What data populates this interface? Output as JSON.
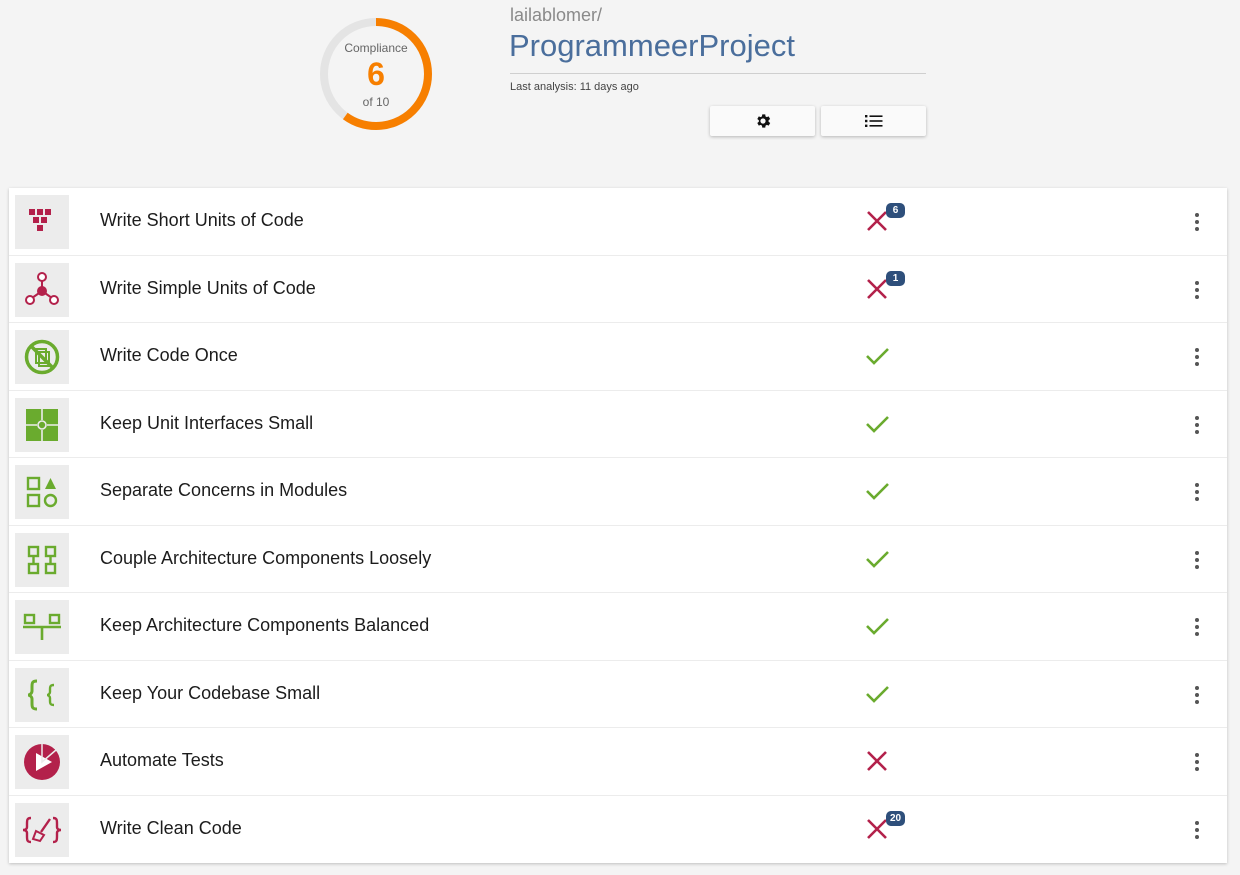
{
  "compliance": {
    "label": "Compliance",
    "score": "6",
    "of_label": "of 10",
    "fraction": 0.6,
    "color": "#f77f00"
  },
  "project": {
    "owner": "lailablomer/",
    "name": "ProgrammeerProject",
    "last_analysis": "Last analysis: 11 days ago"
  },
  "toolbar": {
    "settings_icon": "gear-icon",
    "list_icon": "list-icon"
  },
  "colors": {
    "fail": "#b3214b",
    "pass": "#6aab2e",
    "badge": "#2e4f7b",
    "title": "#4a6e9c"
  },
  "guidelines": [
    {
      "title": "Write Short Units of Code",
      "icon": "short-units-icon",
      "status": "fail",
      "count": "6"
    },
    {
      "title": "Write Simple Units of Code",
      "icon": "simple-units-icon",
      "status": "fail",
      "count": "1"
    },
    {
      "title": "Write Code Once",
      "icon": "no-duplication-icon",
      "status": "pass",
      "count": ""
    },
    {
      "title": "Keep Unit Interfaces Small",
      "icon": "puzzle-icon",
      "status": "pass",
      "count": ""
    },
    {
      "title": "Separate Concerns in Modules",
      "icon": "modules-icon",
      "status": "pass",
      "count": ""
    },
    {
      "title": "Couple Architecture Components Loosely",
      "icon": "components-icon",
      "status": "pass",
      "count": ""
    },
    {
      "title": "Keep Architecture Components Balanced",
      "icon": "balance-icon",
      "status": "pass",
      "count": ""
    },
    {
      "title": "Keep Your Codebase Small",
      "icon": "braces-icon",
      "status": "pass",
      "count": ""
    },
    {
      "title": "Automate Tests",
      "icon": "play-icon",
      "status": "fail",
      "count": ""
    },
    {
      "title": "Write Clean Code",
      "icon": "broom-icon",
      "status": "fail",
      "count": "20"
    }
  ]
}
